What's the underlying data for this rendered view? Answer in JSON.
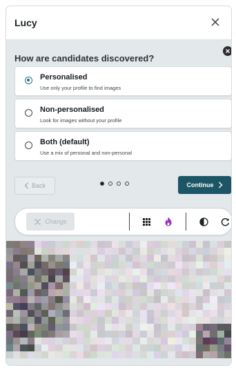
{
  "window": {
    "title": "Lucy",
    "close_icon": "close-icon"
  },
  "prompt": {
    "question": "How are candidates discovered?",
    "dismiss_icon": "dismiss-icon"
  },
  "options": [
    {
      "label": "Personalised",
      "description": "Use only your profile to find images",
      "selected": true
    },
    {
      "label": "Non-personalised",
      "description": "Look for images without your profile",
      "selected": false
    },
    {
      "label": "Both (default)",
      "description": "Use a mix of personal and non-personal",
      "selected": false
    }
  ],
  "navigation": {
    "back_label": "Back",
    "continue_label": "Continue",
    "steps_total": 4,
    "current_step": 1
  },
  "toolbar": {
    "change_label": "Change",
    "tools": [
      "grid-icon",
      "flame-icon",
      "contrast-icon",
      "refresh-icon"
    ]
  },
  "colors": {
    "accent": "#1b5566",
    "flame": "#9b2fc7",
    "selected_radio": "#1e6f8a"
  }
}
